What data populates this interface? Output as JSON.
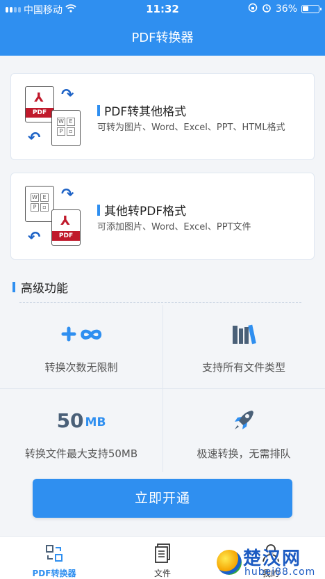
{
  "status": {
    "carrier": "中国移动",
    "time": "11:32",
    "battery": "36%"
  },
  "header": {
    "title": "PDF转换器"
  },
  "cards": [
    {
      "title": "PDF转其他格式",
      "desc": "可转为图片、Word、Excel、PPT、HTML格式",
      "pdf_label": "PDF"
    },
    {
      "title": "其他转PDF格式",
      "desc": "可添加图片、Word、Excel、PPT文件",
      "pdf_label": "PDF"
    }
  ],
  "advanced": {
    "title": "高级功能",
    "features": [
      {
        "label": "转换次数无限制",
        "icon": "plus-infinity-icon"
      },
      {
        "label": "支持所有文件类型",
        "icon": "books-icon"
      },
      {
        "label": "转换文件最大支持50MB",
        "icon": "size-icon",
        "size_value": "50",
        "size_unit": "MB"
      },
      {
        "label": "极速转换，无需排队",
        "icon": "rocket-icon"
      }
    ]
  },
  "cta": {
    "label": "立即开通"
  },
  "tabs": [
    {
      "label": "PDF转换器",
      "icon": "convert-icon",
      "active": true
    },
    {
      "label": "文件",
      "icon": "file-icon",
      "active": false
    },
    {
      "label": "我的",
      "icon": "user-icon",
      "active": false
    }
  ],
  "watermark": {
    "text_cn": "楚汉网",
    "text_url": "hubei88.com"
  },
  "colors": {
    "primary": "#2f8ff0",
    "pdf_red": "#c0192b",
    "dark_blue": "#1e63c6"
  }
}
